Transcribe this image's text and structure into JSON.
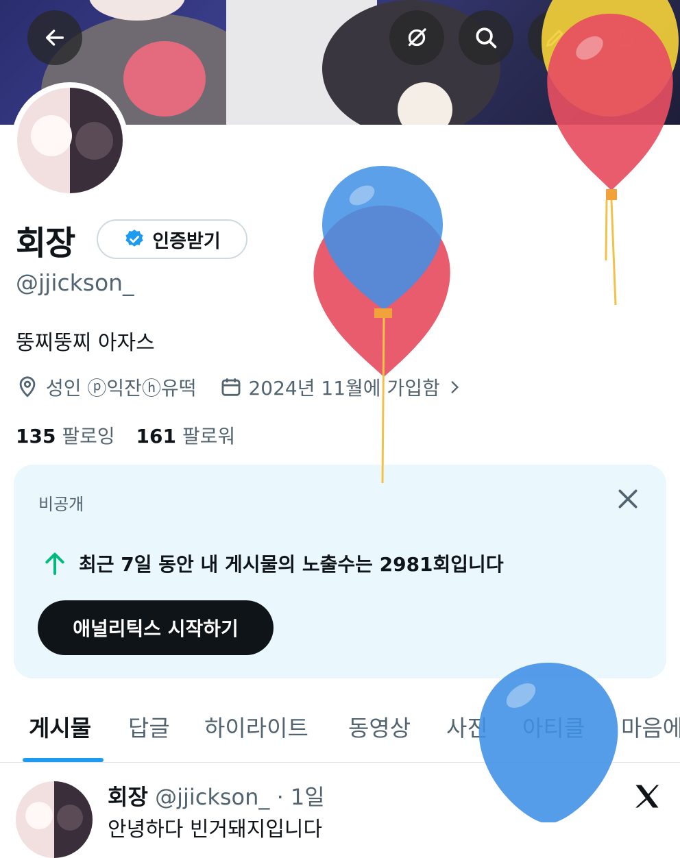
{
  "header": {
    "back_icon": "arrow-left-icon",
    "grok_icon": "grok-icon",
    "search_icon": "search-icon",
    "edit_icon": "pencil-icon",
    "share_icon": "share-icon"
  },
  "profile": {
    "name": "회장",
    "verify_label": "인증받기",
    "handle": "@jjickson_",
    "bio": "뚱찌뚱찌 아자스",
    "location": "성인 ⓟ익잔ⓗ유떡",
    "joined": "2024년 11월에 가입함",
    "following_count": "135",
    "following_label": "팔로잉",
    "followers_count": "161",
    "followers_label": "팔로워"
  },
  "analytics_card": {
    "label": "비공개",
    "text": "최근 7일 동안 내 게시물의 노출수는 2981회입니다",
    "button_label": "애널리틱스 시작하기"
  },
  "tabs": [
    "게시물",
    "답글",
    "하이라이트",
    "동영상",
    "사진",
    "아티클",
    "마음에"
  ],
  "post": {
    "name": "회장",
    "handle": "@jjickson_",
    "time": "· 1일",
    "text": "안녕하다 빈거돼지입니다"
  },
  "colors": {
    "accent": "#1d9bf0",
    "card_bg": "#eaf7fc",
    "up_arrow": "#00ba7c"
  }
}
